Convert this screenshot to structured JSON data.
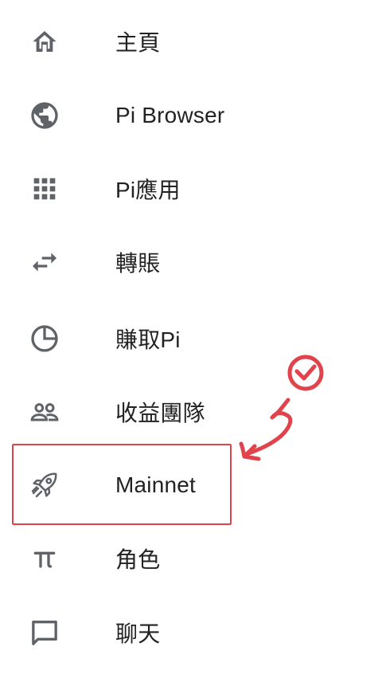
{
  "menu": {
    "items": [
      {
        "label": "主頁",
        "icon": "home-icon"
      },
      {
        "label": "Pi Browser",
        "icon": "globe-icon"
      },
      {
        "label": "Pi應用",
        "icon": "apps-grid-icon"
      },
      {
        "label": "轉賬",
        "icon": "transfer-arrows-icon"
      },
      {
        "label": "賺取Pi",
        "icon": "pie-chart-icon"
      },
      {
        "label": "收益團隊",
        "icon": "team-icon"
      },
      {
        "label": "Mainnet",
        "icon": "rocket-icon"
      },
      {
        "label": "角色",
        "icon": "pi-symbol-icon"
      },
      {
        "label": "聊天",
        "icon": "chat-bubble-icon"
      }
    ],
    "highlighted_item": "Mainnet"
  },
  "colors": {
    "icon": "#5f6368",
    "text": "#222222",
    "annotation_red": "#e0434b"
  }
}
